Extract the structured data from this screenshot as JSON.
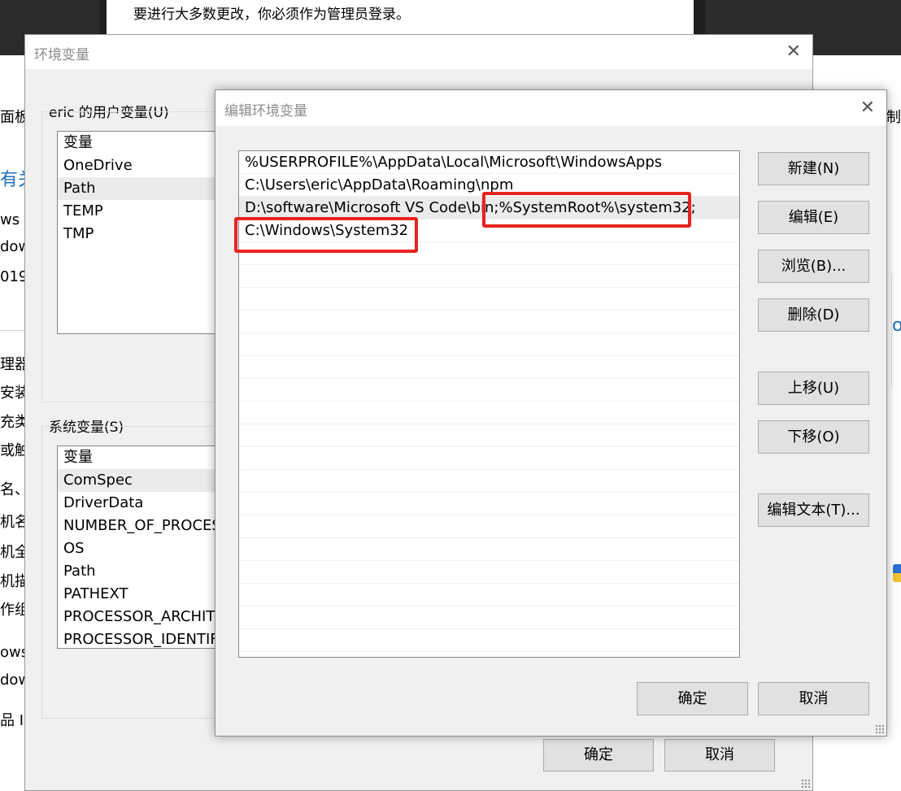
{
  "admin_notice": "要进行大多数更改，你必须作为管理员登录。",
  "background": {
    "fragments": [
      "面板功",
      "有关",
      "ws 版",
      "dow",
      "019",
      "理器:",
      "安装的",
      "充类型",
      "或触控",
      "名、域",
      "机名",
      "机全",
      "机描",
      "作组:",
      "ows 激",
      "dow",
      "品 ID:",
      "制面",
      "ow"
    ]
  },
  "env_dialog": {
    "title": "环境变量",
    "user_vars_label": "eric 的用户变量(U)",
    "user_vars_header": "变量",
    "user_vars": [
      "OneDrive",
      "Path",
      "TEMP",
      "TMP"
    ],
    "system_vars_label": "系统变量(S)",
    "system_vars_header": "变量",
    "system_vars": [
      "ComSpec",
      "DriverData",
      "NUMBER_OF_PROCES",
      "OS",
      "Path",
      "PATHEXT",
      "PROCESSOR_ARCHITE",
      "PROCESSOR_IDENTIFI"
    ],
    "ok": "确定",
    "cancel": "取消"
  },
  "edit_dialog": {
    "title": "编辑环境变量",
    "paths": [
      "%USERPROFILE%\\AppData\\Local\\Microsoft\\WindowsApps",
      "C:\\Users\\eric\\AppData\\Roaming\\npm",
      "D:\\software\\Microsoft VS Code\\bin;%SystemRoot%\\system32;",
      "C:\\Windows\\System32"
    ],
    "buttons": {
      "new": "新建(N)",
      "edit": "编辑(E)",
      "browse": "浏览(B)...",
      "delete": "删除(D)",
      "move_up": "上移(U)",
      "move_down": "下移(O)",
      "edit_text": "编辑文本(T)..."
    },
    "ok": "确定",
    "cancel": "取消"
  },
  "colors": {
    "highlight": "#e8231f",
    "dialog_bg": "#f0f0f0",
    "button_bg": "#e1e1e1"
  }
}
